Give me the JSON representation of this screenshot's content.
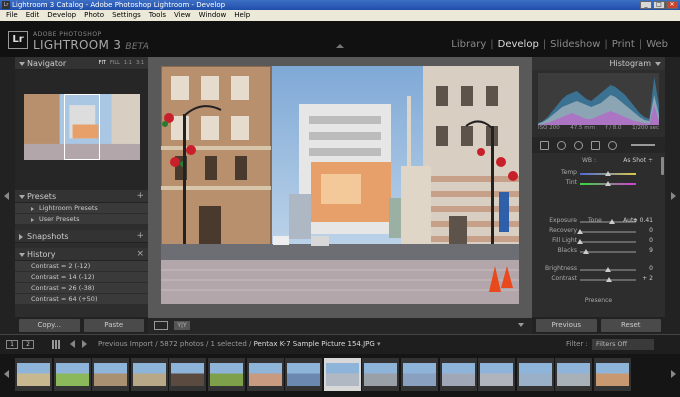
{
  "window": {
    "icon": "Lr",
    "title": "Lightroom 3 Catalog - Adobe Photoshop Lightroom - Develop",
    "min": "_",
    "max": "□",
    "close": "✕"
  },
  "menu": [
    "File",
    "Edit",
    "Develop",
    "Photo",
    "Settings",
    "Tools",
    "View",
    "Window",
    "Help"
  ],
  "identity": {
    "badge": "Lr",
    "brand_top": "ADOBE PHOTOSHOP",
    "brand": "LIGHTROOM 3",
    "beta": "BETA",
    "modules": [
      "Library",
      "Develop",
      "Slideshow",
      "Print",
      "Web"
    ],
    "active_module": "Develop"
  },
  "left": {
    "navigator": {
      "title": "Navigator",
      "opts": [
        "FIT",
        "FILL",
        "1:1",
        "3:1"
      ]
    },
    "presets": {
      "title": "Presets",
      "items": [
        "Lightroom Presets",
        "User Presets"
      ]
    },
    "snapshots": {
      "title": "Snapshots"
    },
    "history": {
      "title": "History",
      "items": [
        "Contrast = 2 (-12)",
        "Contrast = 14 (-12)",
        "Contrast = 26 (-38)",
        "Contrast = 64 (+50)"
      ]
    },
    "copy": "Copy...",
    "paste": "Paste"
  },
  "right": {
    "histogram": {
      "title": "Histogram",
      "iso": "ISO 200",
      "focal": "47.5 mm",
      "aperture": "f / 8.0",
      "shutter": "1/200 sec"
    },
    "wb": "WB :",
    "wb_value": "As Shot ÷",
    "tone": "Tone",
    "auto": "Auto",
    "presence": "Presence",
    "sliders": [
      {
        "label": "Temp",
        "value": "",
        "pos": 0.5
      },
      {
        "label": "Tint",
        "value": "",
        "pos": 0.5
      },
      {
        "label": "Exposure",
        "value": "+ 0.41",
        "pos": 0.58
      },
      {
        "label": "Recovery",
        "value": "0",
        "pos": 0.0
      },
      {
        "label": "Fill Light",
        "value": "0",
        "pos": 0.0
      },
      {
        "label": "Blacks",
        "value": "9",
        "pos": 0.1
      },
      {
        "label": "Brightness",
        "value": "0",
        "pos": 0.5
      },
      {
        "label": "Contrast",
        "value": "+ 2",
        "pos": 0.52
      }
    ],
    "previous": "Previous",
    "reset": "Reset"
  },
  "center": {
    "yy": "Y|Y"
  },
  "filmbar": {
    "one": "1",
    "two": "2",
    "path": "Previous Import / 5872 photos / 1 selected /",
    "file": "Pentax K-7 Sample Picture 154.JPG",
    "filter_label": "Filter :",
    "filter_value": "Filters Off"
  },
  "colors": {
    "sky": "#a9c6e2",
    "building_left": "#c09a78",
    "road": "#b3a6ab",
    "billboard": "#e8a06a"
  },
  "histogram_data": {
    "type": "area",
    "series": [
      {
        "color": "#3b9fd9",
        "values": [
          2,
          4,
          8,
          14,
          20,
          26,
          30,
          32,
          34,
          30,
          26,
          24,
          28,
          32,
          36,
          40,
          38,
          34,
          30,
          24,
          18,
          12,
          8,
          6,
          48,
          20
        ]
      },
      {
        "color": "#d0d0d0",
        "values": [
          1,
          3,
          6,
          10,
          14,
          18,
          20,
          22,
          24,
          22,
          20,
          18,
          20,
          22,
          26,
          30,
          28,
          24,
          20,
          16,
          12,
          8,
          5,
          4,
          30,
          10
        ]
      },
      {
        "color": "#c44fd0",
        "values": [
          0,
          1,
          2,
          4,
          6,
          8,
          10,
          12,
          10,
          8,
          6,
          6,
          8,
          10,
          12,
          14,
          12,
          10,
          8,
          6,
          4,
          3,
          2,
          1,
          20,
          4
        ]
      }
    ]
  },
  "filmstrip_count": 16,
  "filmstrip_selected": 8
}
